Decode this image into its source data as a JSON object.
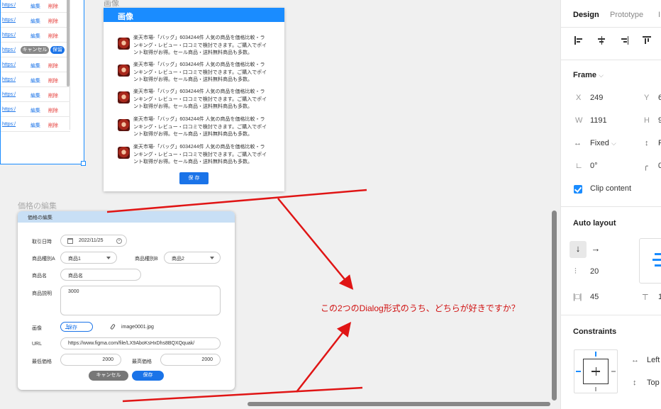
{
  "list": {
    "rows": [
      {
        "url": "https:/",
        "edit": "編集",
        "del": "削除",
        "mode": "view"
      },
      {
        "url": "https:/",
        "edit": "編集",
        "del": "削除",
        "mode": "view"
      },
      {
        "url": "https:/",
        "edit": "編集",
        "del": "削除",
        "mode": "view"
      },
      {
        "url": "https:/",
        "cancel": "キャンセル",
        "save": "保留",
        "mode": "edit"
      },
      {
        "url": "https:/",
        "edit": "編集",
        "del": "削除",
        "mode": "view"
      },
      {
        "url": "https:/",
        "edit": "編集",
        "del": "削除",
        "mode": "view"
      },
      {
        "url": "https:/",
        "edit": "編集",
        "del": "削除",
        "mode": "view"
      },
      {
        "url": "https:/",
        "edit": "編集",
        "del": "削除",
        "mode": "view"
      },
      {
        "url": "https:/",
        "edit": "編集",
        "del": "削除",
        "mode": "view"
      }
    ]
  },
  "image_dialog": {
    "frame_label": "画像",
    "title": "画像",
    "item_text": "楽天市場-「バッグ」6034244件 人気の商品を価格比較・ランキング・レビュー・口コミで検討できます。ご購入でポイント取得がお得。セール商品・送料無料商品も多数。",
    "items": [
      "楽天市場-「バッグ」6034244件 人気の商品を価格比較・ランキング・レビュー・口コミで検討できます。ご購入でポイント取得がお得。セール商品・送料無料商品も多数。",
      "楽天市場-「バッグ」6034244件 人気の商品を価格比較・ランキング・レビュー・口コミで検討できます。ご購入でポイント取得がお得。セール商品・送料無料商品も多数。",
      "楽天市場-「バッグ」6034244件 人気の商品を価格比較・ランキング・レビュー・口コミで検討できます。ご購入でポイント取得がお得。セール商品・送料無料商品も多数。",
      "楽天市場-「バッグ」6034244件 人気の商品を価格比較・ランキング・レビュー・口コミで検討できます。ご購入でポイント取得がお得。セール商品・送料無料商品も多数。",
      "楽天市場-「バッグ」6034244件 人気の商品を価格比較・ランキング・レビュー・口コミで検討できます。ご購入でポイント取得がお得。セール商品・送料無料商品も多数。"
    ],
    "save_label": "保 存"
  },
  "price_dialog": {
    "frame_label": "価格の編集",
    "title": "価格の編集",
    "trade_date_label": "取引日時",
    "trade_date_value": "2022/11/25",
    "category_a_label": "商品種別A",
    "category_a_value": "商品1",
    "category_b_label": "商品種別B",
    "category_b_value": "商品2",
    "name_label": "商品名",
    "name_value": "商品名",
    "desc_label": "商品説明",
    "desc_value": "3000",
    "image_label": "画像",
    "upload_label": "保存",
    "image_file": "image0001.jpg",
    "url_label": "URL",
    "url_value": "https://www.figma.com/file/LX9AboKsHxDhs8BQXQquak/",
    "min_price_label": "最低価格",
    "min_price_value": "2000",
    "max_price_label": "最高価格",
    "max_price_value": "2000",
    "cancel_label": "キャンセル",
    "save_label": "保存"
  },
  "annotation": {
    "text": "この2つのDialog形式のうち、どちらが好きですか？",
    "color": "#d01010"
  },
  "panel": {
    "tabs": [
      "Design",
      "Prototype",
      "I"
    ],
    "frame_title": "Frame",
    "x_key": "X",
    "x_val": "249",
    "y_key": "Y",
    "y_val": "6",
    "w_key": "W",
    "w_val": "1191",
    "h_key": "H",
    "h_val": "9",
    "sizing_val": "Fixed",
    "sizing2_val": "F",
    "rotation_val": "0°",
    "radius_val": "0",
    "clip_label": "Clip content",
    "auto_layout_title": "Auto layout",
    "spacing_val": "20",
    "padding_h_val": "45",
    "padding_v_val": "1",
    "constraints_title": "Constraints",
    "constraint_h": "Left",
    "constraint_v": "Top"
  },
  "colors": {
    "accent": "#1a8cff",
    "annotation_red": "#d01010",
    "delete_red": "#e53935"
  }
}
